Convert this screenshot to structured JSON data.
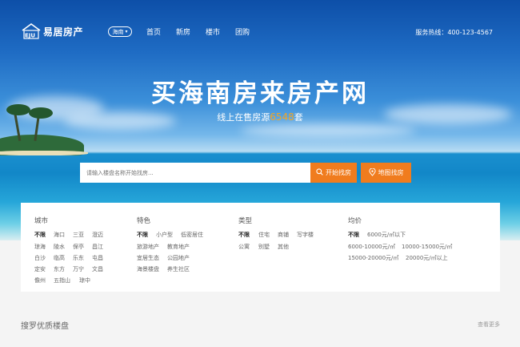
{
  "header": {
    "logo_mark": "EJU",
    "logo_text": "易居房产",
    "city": "海南",
    "nav": [
      "首页",
      "新房",
      "楼市",
      "团购"
    ],
    "hotline": "服务热线：400-123-4567"
  },
  "hero": {
    "headline": "买海南房来房产网",
    "sub_prefix": "线上在售房源",
    "sub_count": "6548",
    "sub_suffix": "套",
    "search_placeholder": "请输入楼盘名称开始找房...",
    "search_button": "开始找房",
    "map_button": "地图找房"
  },
  "filters": {
    "city": {
      "title": "城市",
      "options": [
        "不限",
        "海口",
        "三亚",
        "澄迈",
        "琼海",
        "陵水",
        "保亭",
        "昌江",
        "白沙",
        "临高",
        "乐东",
        "屯昌",
        "定安",
        "东方",
        "万宁",
        "文昌",
        "儋州",
        "五指山",
        "琼中"
      ]
    },
    "feature": {
      "title": "特色",
      "options": [
        "不限",
        "小户型",
        "低密居住",
        "旅游地产",
        "教育地产",
        "宜居生态",
        "公园地产",
        "海景楼盘",
        "养生社区"
      ]
    },
    "type": {
      "title": "类型",
      "options": [
        "不限",
        "住宅",
        "商铺",
        "写字楼",
        "公寓",
        "别墅",
        "其他"
      ]
    },
    "price": {
      "title": "均价",
      "options": [
        "不限",
        "6000元/㎡以下",
        "6000-10000元/㎡",
        "10000-15000元/㎡",
        "15000-20000元/㎡",
        "20000元/㎡以上"
      ]
    }
  },
  "section": {
    "title": "搜罗优质楼盘",
    "more": "查看更多"
  },
  "colors": {
    "accent": "#f07c1e",
    "count_highlight": "#f5a623"
  },
  "icons": [
    "house-logo-icon",
    "chevron-down-icon",
    "search-icon",
    "map-pin-icon"
  ]
}
